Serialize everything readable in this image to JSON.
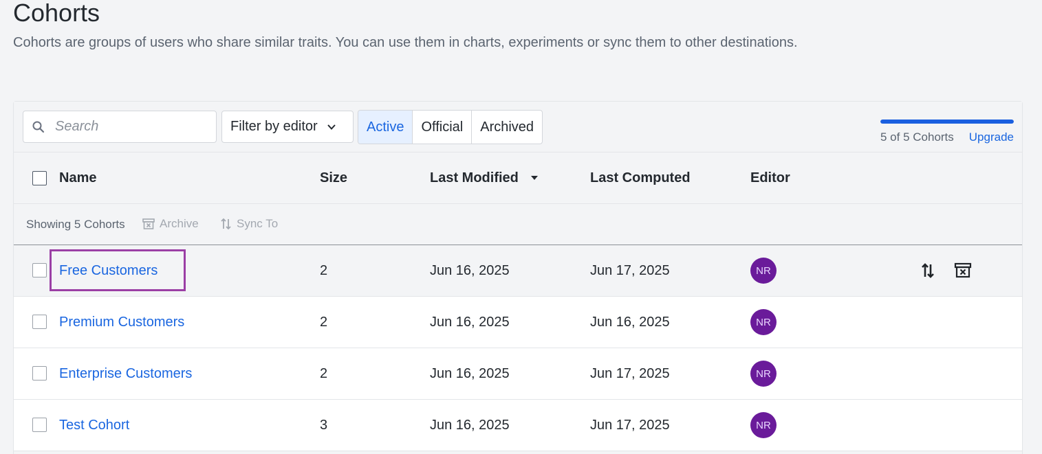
{
  "header": {
    "title": "Cohorts",
    "subtitle": "Cohorts are groups of users who share similar traits. You can use them in charts, experiments or sync them to other destinations."
  },
  "toolbar": {
    "search_placeholder": "Search",
    "filter_label": "Filter by editor",
    "segments": [
      "Active",
      "Official",
      "Archived"
    ],
    "active_segment": "Active",
    "quota_text": "5 of 5 Cohorts",
    "quota_fraction": 1.0,
    "upgrade_label": "Upgrade"
  },
  "table": {
    "columns": {
      "name": "Name",
      "size": "Size",
      "last_modified": "Last Modified",
      "last_computed": "Last Computed",
      "editor": "Editor"
    },
    "bulk": {
      "showing": "Showing 5 Cohorts",
      "archive": "Archive",
      "sync_to": "Sync To"
    },
    "rows": [
      {
        "name": "Free Customers",
        "size": "2",
        "last_modified": "Jun 16, 2025",
        "last_computed": "Jun 17, 2025",
        "editor": "NR"
      },
      {
        "name": "Premium Customers",
        "size": "2",
        "last_modified": "Jun 16, 2025",
        "last_computed": "Jun 16, 2025",
        "editor": "NR"
      },
      {
        "name": "Enterprise Customers",
        "size": "2",
        "last_modified": "Jun 16, 2025",
        "last_computed": "Jun 17, 2025",
        "editor": "NR"
      },
      {
        "name": "Test Cohort",
        "size": "3",
        "last_modified": "Jun 16, 2025",
        "last_computed": "Jun 17, 2025",
        "editor": "NR"
      }
    ]
  },
  "colors": {
    "accent": "#1a66e0",
    "avatar": "#6a1b9a",
    "highlight": "#9b3fa5"
  }
}
